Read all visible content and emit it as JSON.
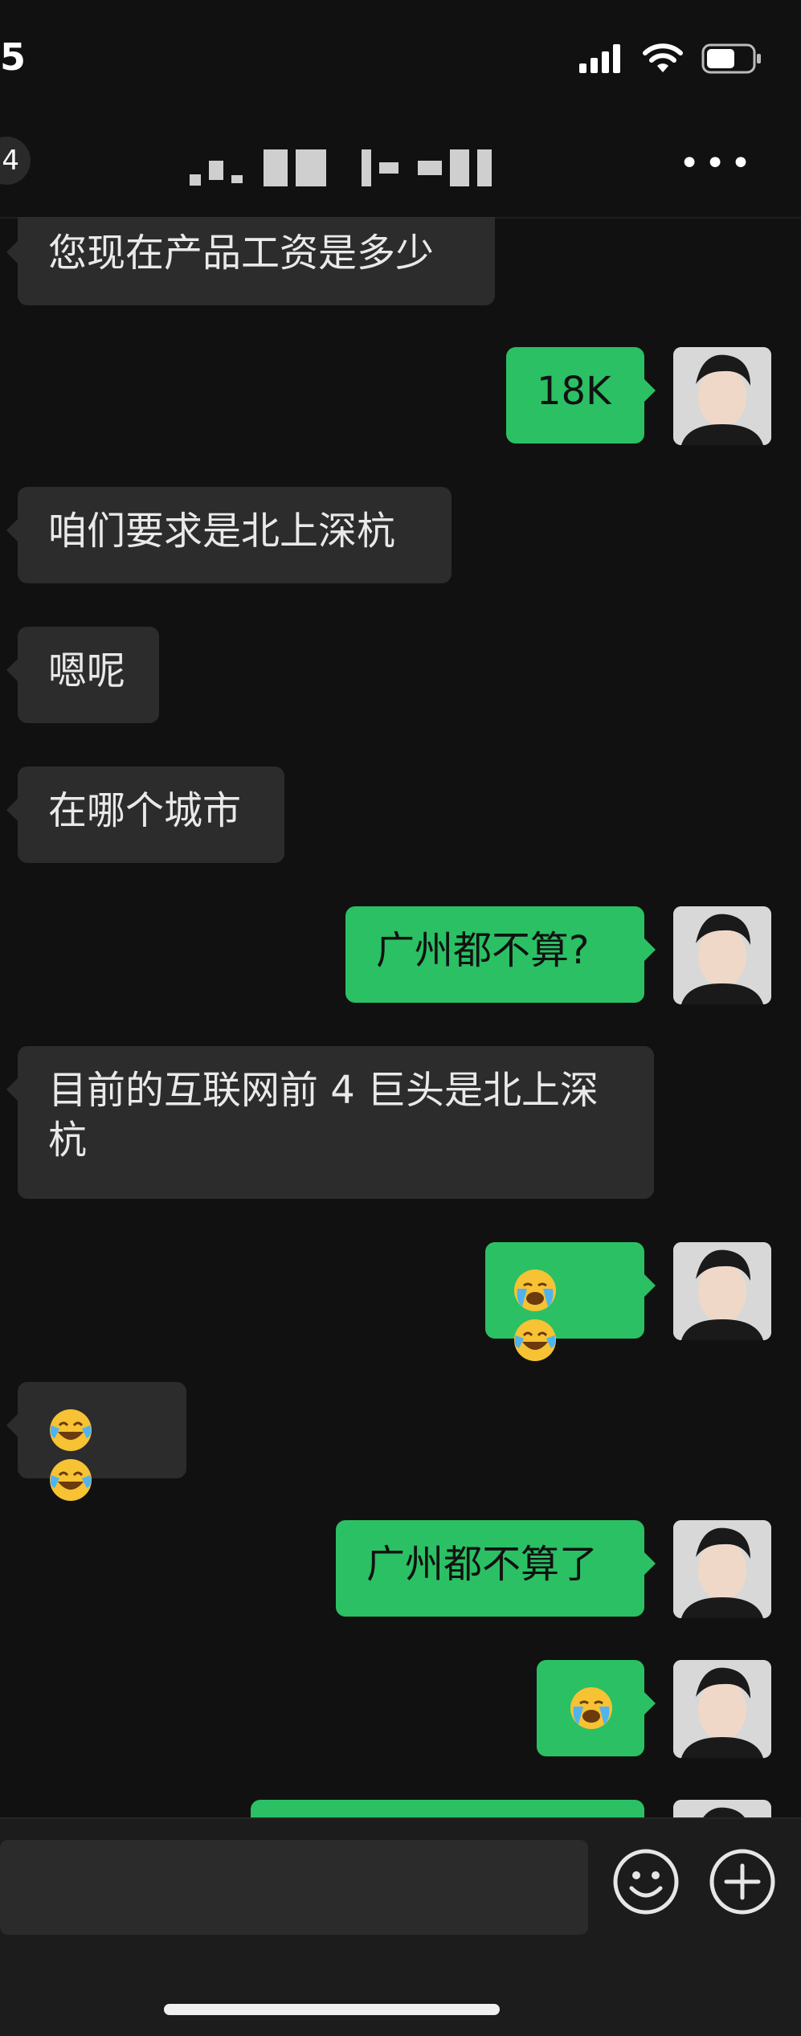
{
  "status_bar": {
    "time": "5"
  },
  "header": {
    "back_badge": "4",
    "more_label": "•••"
  },
  "messages": [
    {
      "side": "in",
      "text": "您现在产品工资是多少"
    },
    {
      "side": "out",
      "text": "18K"
    },
    {
      "side": "in",
      "text": "咱们要求是北上深杭"
    },
    {
      "side": "in",
      "text": "嗯呢"
    },
    {
      "side": "in",
      "text": "在哪个城市"
    },
    {
      "side": "out",
      "text": "广州都不算?"
    },
    {
      "side": "in",
      "line1": "目前的互联网前 4 巨头是北上深",
      "line2": "杭"
    },
    {
      "side": "out",
      "emoji": [
        "loudly-crying-face",
        "face-with-tears-of-joy"
      ]
    },
    {
      "side": "in",
      "emoji": [
        "face-with-tears-of-joy",
        "face-with-tears-of-joy"
      ]
    },
    {
      "side": "out",
      "text": "广州都不算了"
    },
    {
      "side": "out",
      "emoji": [
        "loudly-crying-face"
      ]
    }
  ],
  "colors": {
    "incoming": "#2c2c2c",
    "outgoing": "#2bc064",
    "background": "#111111"
  }
}
